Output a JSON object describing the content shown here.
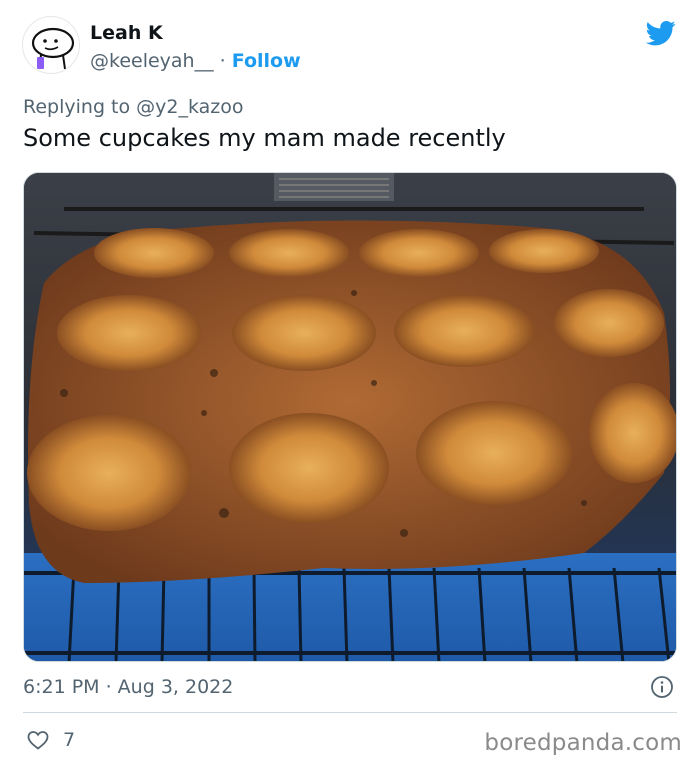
{
  "author": {
    "name": "Leah K",
    "handle": "@keeleyah__",
    "separator": "·",
    "follow_label": "Follow"
  },
  "reply": {
    "prefix": "Replying to ",
    "handle": "@y2_kazoo"
  },
  "tweet": {
    "text": "Some cupcakes my mam made recently",
    "timestamp": "6:21 PM · Aug 3, 2022",
    "like_count": "7"
  },
  "watermark": "boredpanda.com",
  "colors": {
    "accent": "#1d9bf0",
    "secondary_text": "#536471",
    "primary_text": "#0f1419"
  },
  "icons": {
    "brand": "twitter-bird-icon",
    "info": "info-icon",
    "like": "heart-icon"
  }
}
